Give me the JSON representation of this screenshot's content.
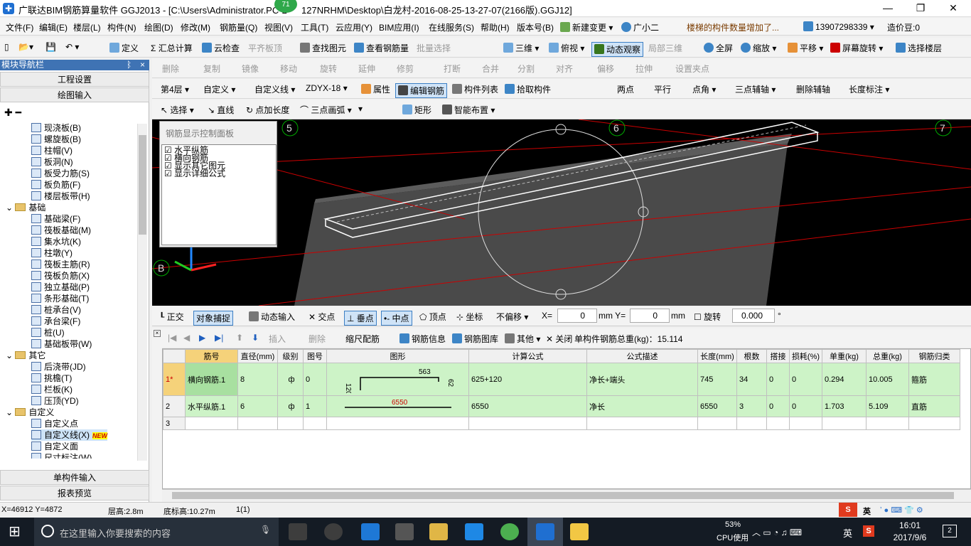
{
  "title": "广联达BIM钢筋算量软件 GGJ2013 - [C:\\Users\\Administrator.PC-2",
  "title_tail": "127NRHM\\Desktop\\白龙村-2016-08-25-13-27-07(2166版).GGJ12]",
  "badge": "71",
  "menu": [
    "文件(F)",
    "编辑(E)",
    "楼层(L)",
    "构件(N)",
    "绘图(D)",
    "修改(M)",
    "钢筋量(Q)",
    "视图(V)",
    "工具(T)",
    "云应用(Y)",
    "BIM应用(I)",
    "在线服务(S)",
    "帮助(H)",
    "版本号(B)",
    "新建变更",
    "广小二"
  ],
  "notice": "楼梯的构件数量增加了...",
  "phone": "13907298339",
  "price": "造价豆:0",
  "toolbar1": [
    "定义",
    "Σ 汇总计算",
    "云检查",
    "平齐板顶",
    "查找图元",
    "查看钢筋量",
    "批量选择",
    "三维",
    "俯视",
    "动态观察",
    "局部三维",
    "全屏",
    "缩放",
    "平移",
    "屏幕旋转",
    "选择楼层"
  ],
  "toolbar2": [
    "删除",
    "复制",
    "镜像",
    "移动",
    "旋转",
    "延伸",
    "修剪",
    "打断",
    "合并",
    "分割",
    "对齐",
    "偏移",
    "拉伸",
    "设置夹点"
  ],
  "toolbar3": {
    "floor": "第4层",
    "type": "自定义",
    "sub": "自定义线",
    "name": "ZDYX-18",
    "buttons": [
      "属性",
      "编辑钢筋",
      "构件列表",
      "拾取构件"
    ],
    "right": [
      "两点",
      "平行",
      "点角",
      "三点辅轴",
      "删除辅轴",
      "长度标注"
    ]
  },
  "toolbar4": [
    "选择",
    "直线",
    "点加长度",
    "三点画弧",
    "矩形",
    "智能布置"
  ],
  "nav": {
    "header": "模块导航栏",
    "pin": "ᛒ",
    "close": "×",
    "eng": "工程设置",
    "draw": "绘图输入",
    "tree": [
      {
        "t": "现浇板(B)",
        "lv": 2
      },
      {
        "t": "螺旋板(B)",
        "lv": 2
      },
      {
        "t": "柱帽(V)",
        "lv": 2
      },
      {
        "t": "板洞(N)",
        "lv": 2
      },
      {
        "t": "板受力筋(S)",
        "lv": 2
      },
      {
        "t": "板负筋(F)",
        "lv": 2
      },
      {
        "t": "楼层板带(H)",
        "lv": 2
      },
      {
        "t": "基础",
        "lv": 1
      },
      {
        "t": "基础梁(F)",
        "lv": 2
      },
      {
        "t": "筏板基础(M)",
        "lv": 2
      },
      {
        "t": "集水坑(K)",
        "lv": 2
      },
      {
        "t": "柱墩(Y)",
        "lv": 2
      },
      {
        "t": "筏板主筋(R)",
        "lv": 2
      },
      {
        "t": "筏板负筋(X)",
        "lv": 2
      },
      {
        "t": "独立基础(P)",
        "lv": 2
      },
      {
        "t": "条形基础(T)",
        "lv": 2
      },
      {
        "t": "桩承台(V)",
        "lv": 2
      },
      {
        "t": "承台梁(F)",
        "lv": 2
      },
      {
        "t": "桩(U)",
        "lv": 2
      },
      {
        "t": "基础板带(W)",
        "lv": 2
      },
      {
        "t": "其它",
        "lv": 1
      },
      {
        "t": "后浇带(JD)",
        "lv": 2
      },
      {
        "t": "挑檐(T)",
        "lv": 2
      },
      {
        "t": "栏板(K)",
        "lv": 2
      },
      {
        "t": "压顶(YD)",
        "lv": 2
      },
      {
        "t": "自定义",
        "lv": 1
      },
      {
        "t": "自定义点",
        "lv": 2
      },
      {
        "t": "自定义线(X)",
        "lv": 2,
        "new": "NEW"
      },
      {
        "t": "自定义面",
        "lv": 2
      },
      {
        "t": "尺寸标注(W)",
        "lv": 2
      }
    ],
    "single": "单构件输入",
    "report": "报表预览"
  },
  "ctrl_panel": {
    "title": "钢筋显示控制面板",
    "items": [
      "水平纵筋",
      "横向钢筋",
      "显示其它图元",
      "显示详细公式"
    ]
  },
  "axis_labels": [
    "5",
    "6",
    "7",
    "B"
  ],
  "snap": {
    "items": [
      "正交",
      "对象捕捉",
      "动态输入",
      "交点",
      "垂点",
      "中点",
      "顶点",
      "坐标"
    ],
    "offset": "不偏移",
    "x_label": "X=",
    "x": "0",
    "y_label": "mm Y=",
    "y": "0",
    "mm": "mm",
    "rotate": "旋转",
    "rot_val": "0.000",
    "deg": "°"
  },
  "rebar_bar": {
    "items": [
      "插入",
      "删除",
      "缩尺配筋",
      "钢筋信息",
      "钢筋图库",
      "其他",
      "关闭"
    ],
    "total": "单构件钢筋总重(kg)：15.114"
  },
  "table": {
    "headers": [
      "筋号",
      "直径(mm)",
      "级别",
      "图号",
      "图形",
      "计算公式",
      "公式描述",
      "长度(mm)",
      "根数",
      "搭接",
      "损耗(%)",
      "单重(kg)",
      "总重(kg)",
      "钢筋归类"
    ],
    "rows": [
      {
        "no": "1*",
        "cells": [
          "横向钢筋.1",
          "8",
          "ф",
          "0",
          "",
          "625+120",
          "净长+端头",
          "745",
          "34",
          "0",
          "0",
          "0.294",
          "10.005",
          "箍筋"
        ],
        "shape": {
          "a": "563",
          "b": "120",
          "c": "62"
        }
      },
      {
        "no": "2",
        "cells": [
          "水平纵筋.1",
          "6",
          "ф",
          "1",
          "",
          "6550",
          "净长",
          "6550",
          "3",
          "0",
          "0",
          "1.703",
          "5.109",
          "直筋"
        ],
        "shape": {
          "a": "6550"
        }
      },
      {
        "no": "3",
        "cells": [
          "",
          "",
          "",
          "",
          "",
          "",
          "",
          "",
          "",
          "",
          "",
          "",
          "",
          ""
        ]
      }
    ]
  },
  "status": {
    "coord": "X=46912 Y=4872",
    "floor_h": "层高:2.8m",
    "base_h": "底标高:10.27m",
    "count": "1(1)"
  },
  "tray_ime": "英",
  "taskbar": {
    "search": "在这里输入你要搜索的内容",
    "cpu": "53%",
    "cpu_label": "CPU使用",
    "lang": "英",
    "time": "16:01",
    "date": "2017/9/6",
    "notif": "2"
  }
}
